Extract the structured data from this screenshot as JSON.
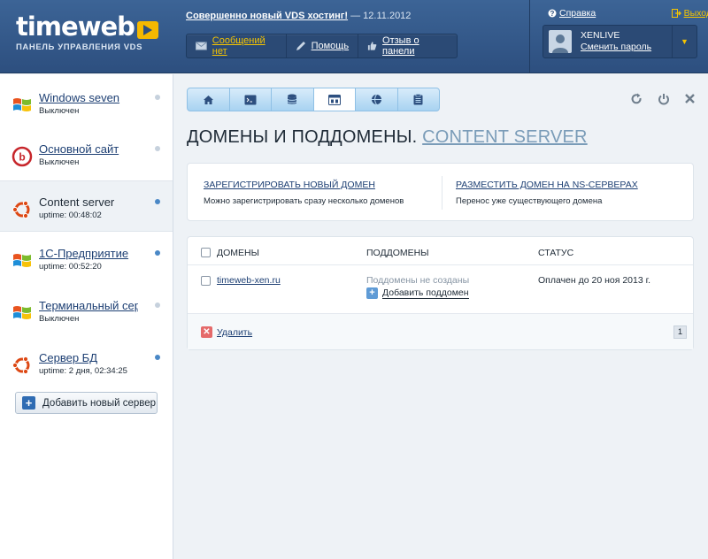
{
  "brand": {
    "logo": "timeweb",
    "subtitle": "ПАНЕЛЬ УПРАВЛЕНИЯ VDS",
    "accent": "#f5b800"
  },
  "news": {
    "link": "Совершенно новый VDS хостинг!",
    "date": "— 12.11.2012"
  },
  "toolbar": {
    "messages": "Сообщений нет",
    "help": "Помощь",
    "feedback": "Отзыв о панели"
  },
  "top_links": {
    "help": "Справка",
    "exit": "Выход"
  },
  "user": {
    "name": "XENLIVE",
    "change_password": "Сменить пароль"
  },
  "servers": [
    {
      "name": "Windows seven",
      "status": "Выключен",
      "icon": "windows-icon",
      "online": false
    },
    {
      "name": "Основной сайт",
      "status": "Выключен",
      "icon": "bitrix-icon",
      "online": false
    },
    {
      "name": "Content server",
      "status": "uptime: 00:48:02",
      "icon": "ubuntu-icon",
      "online": true
    },
    {
      "name": "1С-Предприятие",
      "status": "uptime: 00:52:20",
      "icon": "windows-icon",
      "online": true
    },
    {
      "name": "Терминальный сервер",
      "status": "Выключен",
      "icon": "windows-icon",
      "online": false
    },
    {
      "name": "Сервер БД",
      "status": "uptime: 2 дня, 02:34:25",
      "icon": "ubuntu-icon",
      "online": true
    }
  ],
  "add_server": "Добавить новый сервер",
  "tabs": [
    "home-icon",
    "console-icon",
    "database-icon",
    "domains-icon",
    "dns-icon",
    "clipboard-icon"
  ],
  "page": {
    "title": "ДОМЕНЫ И ПОДДОМЕНЫ.",
    "server": "CONTENT SERVER"
  },
  "actions": {
    "register": {
      "label": "ЗАРЕГИСТРИРОВАТЬ НОВЫЙ ДОМЕН",
      "desc": "Можно зарегистрировать сразу несколько доменов"
    },
    "ns": {
      "label": "РАЗМЕСТИТЬ ДОМЕН НА NS-СЕРВЕРАХ",
      "desc": "Перенос уже существующего домена"
    }
  },
  "table": {
    "headers": {
      "domains": "ДОМЕНЫ",
      "subdomains": "ПОДДОМЕНЫ",
      "status": "СТАТУС"
    },
    "rows": [
      {
        "domain": "timeweb-xen.ru",
        "subdomains": "Поддомены не созданы",
        "add_subdomain": "Добавить поддомен",
        "status": "Оплачен до 20 ноя 2013 г."
      }
    ]
  },
  "footer": {
    "delete": "Удалить",
    "page": "1"
  }
}
